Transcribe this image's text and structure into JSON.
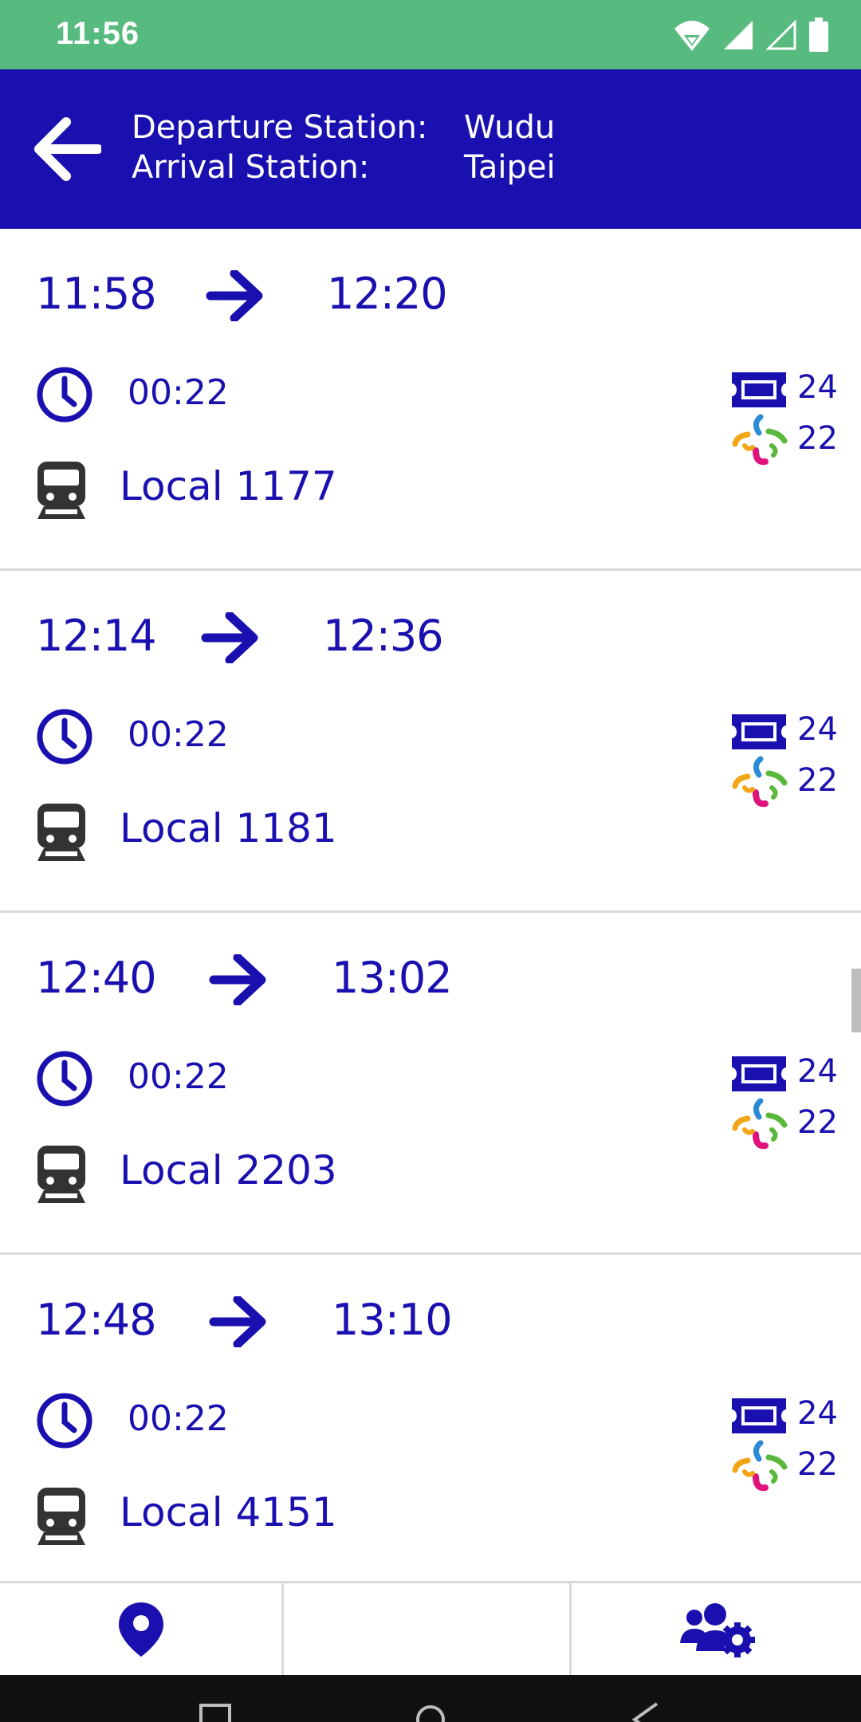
{
  "status_bar": {
    "time": "11:56"
  },
  "header": {
    "departure_label": "Departure Station:",
    "arrival_label": "Arrival Station:",
    "departure_value": "Wudu",
    "arrival_value": "Taipei"
  },
  "trips": [
    {
      "depart": "11:58",
      "arrive": "12:20",
      "duration": "00:22",
      "train": "Local 1177",
      "ticket_price": "24",
      "card_price": "22"
    },
    {
      "depart": "12:14",
      "arrive": "12:36",
      "duration": "00:22",
      "train": "Local 1181",
      "ticket_price": "24",
      "card_price": "22"
    },
    {
      "depart": "12:40",
      "arrive": "13:02",
      "duration": "00:22",
      "train": "Local 2203",
      "ticket_price": "24",
      "card_price": "22"
    },
    {
      "depart": "12:48",
      "arrive": "13:10",
      "duration": "00:22",
      "train": "Local 4151",
      "ticket_price": "24",
      "card_price": "22"
    }
  ],
  "bottom_tabs": [
    {
      "icon": "location-pin-icon"
    },
    {
      "icon": ""
    },
    {
      "icon": "users-settings-icon"
    }
  ],
  "colors": {
    "primary": "#1a10b0",
    "status_bar": "#57bb7f",
    "divider": "#d9d9d9",
    "train_icon": "#333333"
  }
}
